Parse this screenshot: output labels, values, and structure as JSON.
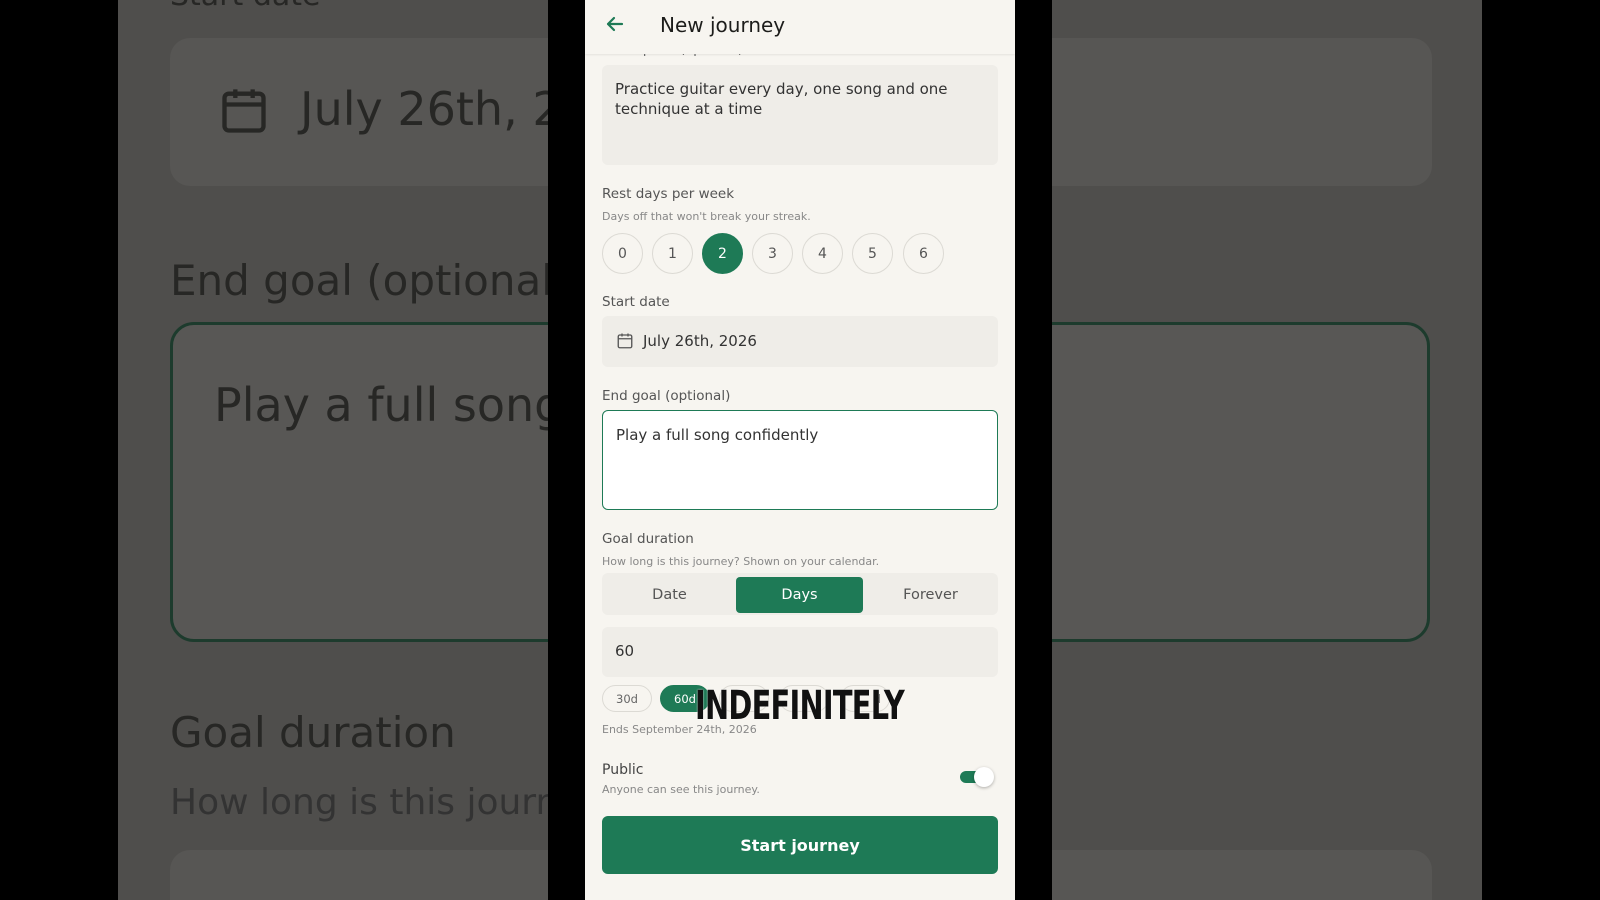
{
  "background": {
    "left_label_top": "Start date",
    "left_date": "July 26th, 2",
    "left_end_goal": "End goal (optional",
    "left_goal_text": "Play a full song",
    "left_goal_duration": "Goal duration",
    "left_hint": "How long is this journe"
  },
  "appbar": {
    "title": "New journey"
  },
  "description": {
    "label": "Description (optional)",
    "value": "Practice guitar every day, one song and one technique at a time"
  },
  "rest_days": {
    "label": "Rest days per week",
    "hint": "Days off that won't break your streak.",
    "options": [
      "0",
      "1",
      "2",
      "3",
      "4",
      "5",
      "6"
    ],
    "selected": "2"
  },
  "start_date": {
    "label": "Start date",
    "value": "July 26th, 2026"
  },
  "end_goal": {
    "label": "End goal (optional)",
    "value": "Play a full song confidently"
  },
  "goal_duration": {
    "label": "Goal duration",
    "hint": "How long is this journey? Shown on your calendar.",
    "tabs": [
      "Date",
      "Days",
      "Forever"
    ],
    "selected_tab": "Days",
    "days_value": "60",
    "chips": [
      "30d",
      "60d",
      "",
      "",
      "d"
    ],
    "selected_chip": "60d",
    "ends_text": "Ends September 24th, 2026"
  },
  "caption": "INDEFINITELY",
  "public": {
    "label": "Public",
    "hint": "Anyone can see this journey.",
    "enabled": true
  },
  "submit": {
    "label": "Start journey"
  },
  "colors": {
    "accent": "#1e7a56",
    "surface": "#f7f5f0",
    "field": "#efede8"
  }
}
